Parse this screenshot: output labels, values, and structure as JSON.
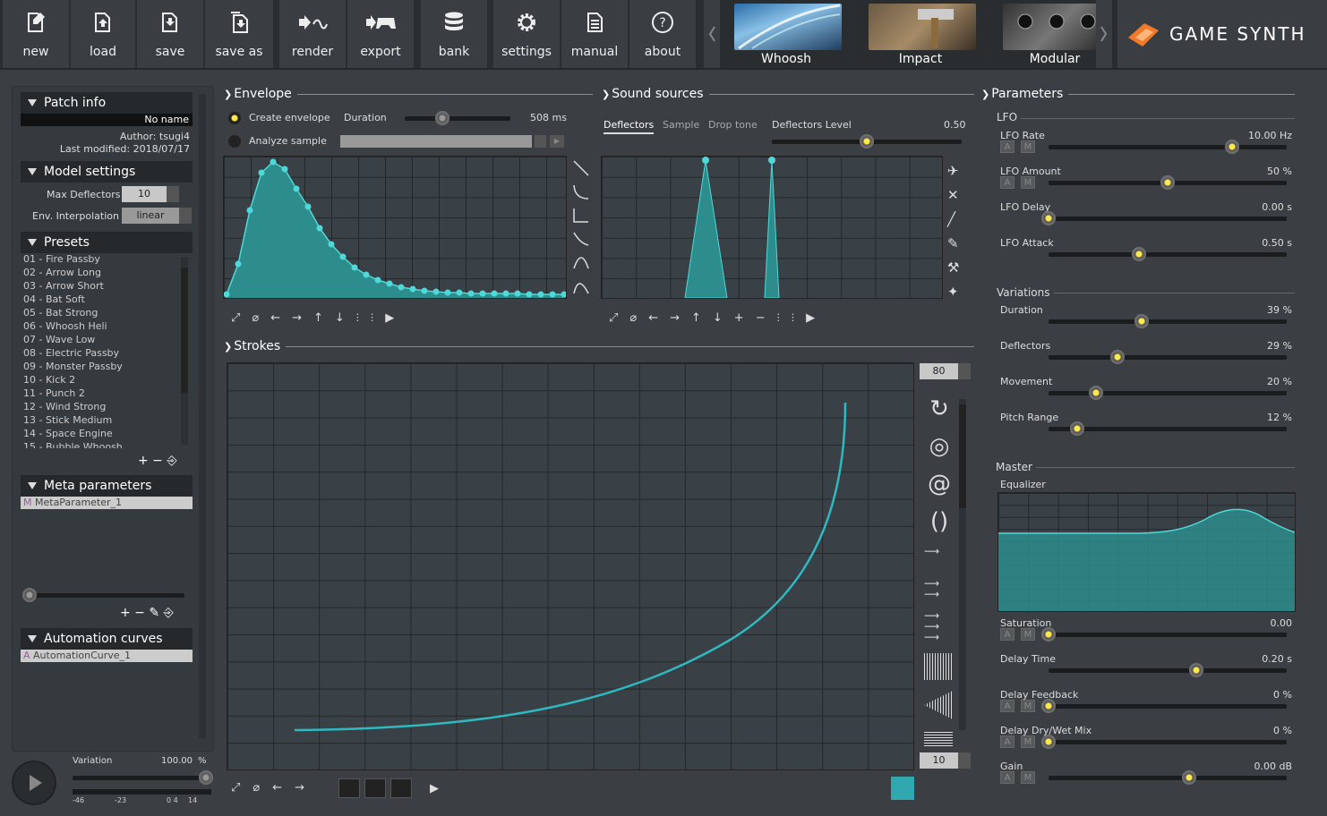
{
  "toolbar": {
    "new": "new",
    "load": "load",
    "save": "save",
    "save_as": "save as",
    "render": "render",
    "export": "export",
    "bank": "bank",
    "settings": "settings",
    "manual": "manual",
    "about": "about"
  },
  "models": [
    {
      "label": "Whoosh"
    },
    {
      "label": "Impact"
    },
    {
      "label": "Modular"
    }
  ],
  "brand": "GAME SYNTH",
  "patch": {
    "title": "Patch info",
    "name": "No name",
    "author": "Author: tsugi4",
    "modified": "Last modified: 2018/07/17"
  },
  "model_settings": {
    "title": "Model settings",
    "max_deflectors_label": "Max Deflectors",
    "max_deflectors": "10",
    "interp_label": "Env. Interpolation",
    "interp": "linear"
  },
  "presets": {
    "title": "Presets",
    "items": [
      "01 - Fire Passby",
      "02 - Arrow Long",
      "03 - Arrow Short",
      "04 - Bat Soft",
      "05 - Bat Strong",
      "06 - Whoosh Heli",
      "07 - Wave Low",
      "08 - Electric Passby",
      "09 - Monster Passby",
      "10 - Kick 2",
      "11 - Punch 2",
      "12 - Wind Strong",
      "13 - Stick Medium",
      "14 - Space Engine",
      "15 - Bubble Whoosh"
    ]
  },
  "meta": {
    "title": "Meta parameters",
    "item": "MetaParameter_1",
    "prefix": "M"
  },
  "automation": {
    "title": "Automation curves",
    "item": "AutomationCurve_1",
    "prefix": "A"
  },
  "variation": {
    "label": "Variation",
    "value": "100.00",
    "unit": "%",
    "level": 1.0,
    "meter_ticks": [
      "-46",
      "-23",
      "0 4",
      "14"
    ]
  },
  "envelope": {
    "title": "Envelope",
    "create": "Create envelope",
    "analyze": "Analyze sample",
    "duration_label": "Duration",
    "duration": "508 ms"
  },
  "sound": {
    "title": "Sound sources",
    "tabs": [
      "Deflectors",
      "Sample",
      "Drop tone"
    ],
    "level_label": "Deflectors Level",
    "level": "0.50"
  },
  "strokes": {
    "title": "Strokes",
    "top_value": "80",
    "bottom_value": "10"
  },
  "params": {
    "title": "Parameters",
    "lfo_title": "LFO",
    "lfo": [
      {
        "label": "LFO Rate",
        "value": "10.00 Hz",
        "level": 0.77
      },
      {
        "label": "LFO Amount",
        "value": "50 %",
        "level": 0.5
      },
      {
        "label": "LFO Delay",
        "value": "0.00 s",
        "level": 0.0
      },
      {
        "label": "LFO Attack",
        "value": "0.50 s",
        "level": 0.38
      }
    ],
    "var_title": "Variations",
    "variations": [
      {
        "label": "Duration",
        "value": "39 %",
        "level": 0.39
      },
      {
        "label": "Deflectors",
        "value": "29 %",
        "level": 0.29
      },
      {
        "label": "Movement",
        "value": "20 %",
        "level": 0.2
      },
      {
        "label": "Pitch Range",
        "value": "12 %",
        "level": 0.12
      }
    ],
    "master_title": "Master",
    "eq_label": "Equalizer",
    "master": [
      {
        "label": "Saturation",
        "value": "0.00",
        "level": 0.0
      },
      {
        "label": "Delay Time",
        "value": "0.20 s",
        "level": 0.62
      },
      {
        "label": "Delay Feedback",
        "value": "0 %",
        "level": 0.0
      },
      {
        "label": "Delay Dry/Wet Mix",
        "value": "0 %",
        "level": 0.0
      },
      {
        "label": "Gain",
        "value": "0.00 dB",
        "level": 0.59
      }
    ]
  },
  "colors": {
    "accent": "#4fd8d8",
    "fill": "#2d8c8c",
    "knob": "#ffe94a"
  }
}
